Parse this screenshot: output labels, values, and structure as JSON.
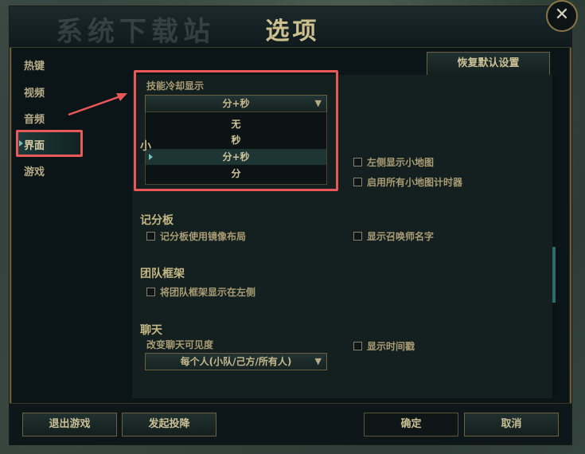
{
  "window": {
    "title": "选项",
    "watermark": "系统下载站"
  },
  "nav": [
    {
      "label": "热键"
    },
    {
      "label": "视频"
    },
    {
      "label": "音频"
    },
    {
      "label": "界面",
      "active": true
    },
    {
      "label": "游戏"
    }
  ],
  "toolbar": {
    "restore_defaults": "恢复默认设置"
  },
  "ability_cooldown": {
    "label": "技能冷却显示",
    "selected": "分+秒",
    "options": [
      "无",
      "秒",
      "分+秒",
      "分"
    ]
  },
  "minimap": {
    "partial_heading": "小",
    "checks": [
      {
        "label": "左侧显示小地图",
        "checked": false
      },
      {
        "label": "启用所有小地图计时器",
        "checked": false
      }
    ]
  },
  "scoreboard": {
    "heading": "记分板",
    "checks": [
      {
        "label": "记分板使用镜像布局",
        "checked": false
      },
      {
        "label": "显示召唤师名字",
        "checked": false
      }
    ]
  },
  "team_frames": {
    "heading": "团队框架",
    "checks": [
      {
        "label": "将团队框架显示在左侧",
        "checked": false
      }
    ]
  },
  "chat": {
    "heading": "聊天",
    "visibility_label": "改变聊天可见度",
    "visibility_value": "每个人(小队/己方/所有人)",
    "checks": [
      {
        "label": "显示时间戳",
        "checked": false
      }
    ]
  },
  "footer": {
    "exit_game": "退出游戏",
    "surrender": "发起投降",
    "ok": "确定",
    "cancel": "取消"
  },
  "colors": {
    "highlight_annotation": "#ea5757",
    "gold_text": "#c6b88c",
    "panel_bg": "#13201f"
  }
}
